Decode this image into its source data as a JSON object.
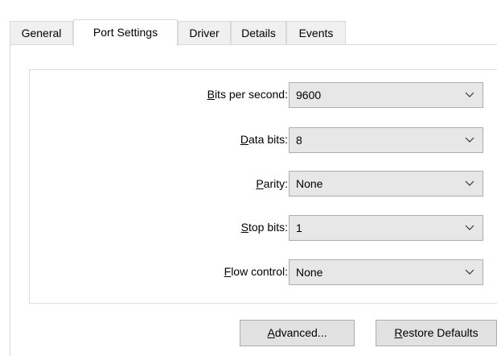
{
  "tabs": [
    {
      "label": "General"
    },
    {
      "label": "Port Settings"
    },
    {
      "label": "Driver"
    },
    {
      "label": "Details"
    },
    {
      "label": "Events"
    }
  ],
  "active_tab": "Port Settings",
  "settings": {
    "bits_per_second": {
      "label_accel": "B",
      "label_rest": "its per second:",
      "value": "9600"
    },
    "data_bits": {
      "label_accel": "D",
      "label_rest": "ata bits:",
      "value": "8"
    },
    "parity": {
      "label_accel": "P",
      "label_rest": "arity:",
      "value": "None"
    },
    "stop_bits": {
      "label_accel": "S",
      "label_rest": "top bits:",
      "value": "1"
    },
    "flow_control": {
      "label_accel": "F",
      "label_rest": "low control:",
      "value": "None"
    }
  },
  "buttons": {
    "advanced": {
      "label_accel": "A",
      "label_rest": "dvanced..."
    },
    "restore": {
      "label_accel": "R",
      "label_rest": "estore Defaults"
    }
  },
  "icons": {
    "combo_arrow": "chevron-down-icon"
  }
}
